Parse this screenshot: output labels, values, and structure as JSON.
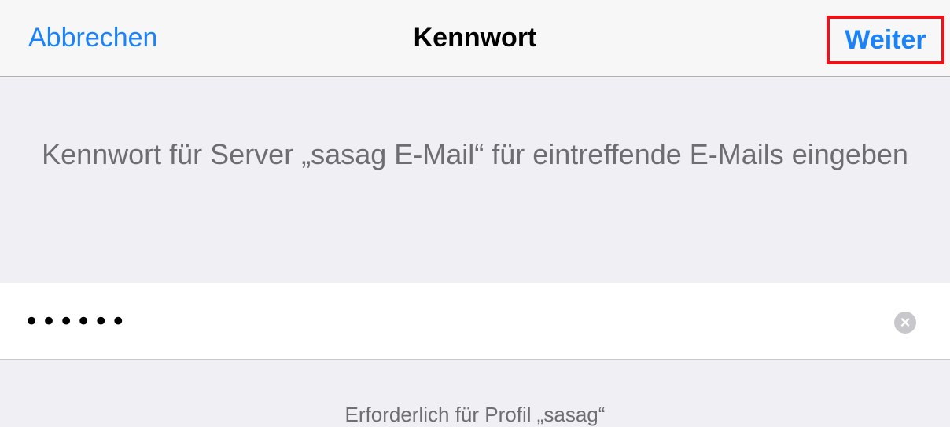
{
  "navbar": {
    "cancel_label": "Abbrechen",
    "title": "Kennwort",
    "next_label": "Weiter"
  },
  "prompt": {
    "text": "Kennwort für Server „sasag E-Mail“ für eintreffende E-Mails eingeben"
  },
  "password_field": {
    "value": "••••••",
    "clear_icon": "clear-circle-x-icon"
  },
  "footer": {
    "note": "Erforderlich für Profil „sasag“"
  },
  "colors": {
    "accent": "#1a82fb",
    "highlight_border": "#e8131b",
    "background": "#efeff4"
  }
}
